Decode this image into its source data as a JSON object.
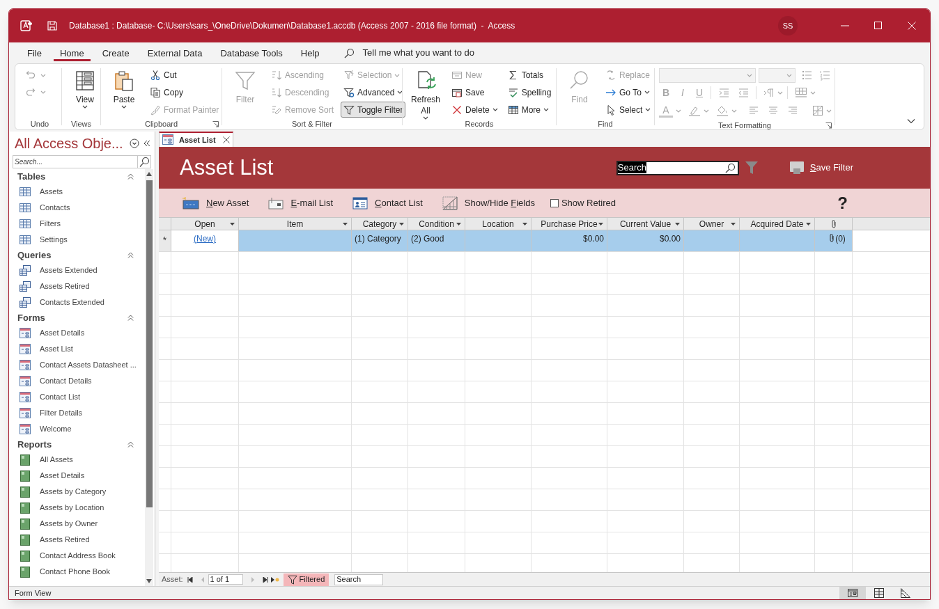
{
  "window": {
    "title": "Database1 : Database- C:\\Users\\sars_\\OneDrive\\Dokumen\\Database1.accdb (Access 2007 - 2016 file format)  -  Access",
    "user_initials": "SS"
  },
  "menu_tabs": [
    {
      "label": "File",
      "selected": false
    },
    {
      "label": "Home",
      "selected": true
    },
    {
      "label": "Create",
      "selected": false
    },
    {
      "label": "External Data",
      "selected": false
    },
    {
      "label": "Database Tools",
      "selected": false
    },
    {
      "label": "Help",
      "selected": false
    }
  ],
  "tell_me": {
    "placeholder": "Tell me what you want to do"
  },
  "ribbon": {
    "groups": [
      {
        "kind": "commands",
        "label": "Undo",
        "launcher": false,
        "items": [
          {
            "kind": "icon",
            "disabled": true,
            "dropdown": true,
            "pressed": false
          },
          {
            "kind": "icon",
            "disabled": true,
            "dropdown": true,
            "pressed": false
          }
        ]
      },
      {
        "kind": "commands",
        "label": "Views",
        "launcher": false,
        "items": [
          {
            "kind": "large",
            "label": "View",
            "disabled": false,
            "dropdown": true,
            "pressed": false
          }
        ]
      },
      {
        "kind": "commands",
        "label": "Clipboard",
        "launcher": true,
        "items": [
          {
            "kind": "large",
            "label": "Paste",
            "disabled": false,
            "dropdown": true,
            "pressed": false
          },
          {
            "kind": "small",
            "label": "Cut",
            "disabled": false,
            "dropdown": false,
            "pressed": false
          },
          {
            "kind": "small",
            "label": "Copy",
            "disabled": false,
            "dropdown": false,
            "pressed": false
          },
          {
            "kind": "small",
            "label": "Format Painter",
            "disabled": true,
            "dropdown": false,
            "pressed": false
          }
        ]
      },
      {
        "kind": "commands",
        "label": "Sort & Filter",
        "launcher": false,
        "items": [
          {
            "kind": "large",
            "label": "Filter",
            "disabled": true,
            "dropdown": false,
            "pressed": false
          },
          {
            "kind": "small",
            "label": "Ascending",
            "disabled": true,
            "dropdown": false,
            "pressed": false
          },
          {
            "kind": "small",
            "label": "Descending",
            "disabled": true,
            "dropdown": false,
            "pressed": false
          },
          {
            "kind": "small",
            "label": "Remove Sort",
            "disabled": true,
            "dropdown": false,
            "pressed": false
          },
          {
            "kind": "small",
            "label": "Selection",
            "disabled": true,
            "dropdown": true,
            "pressed": false
          },
          {
            "kind": "small",
            "label": "Advanced",
            "disabled": false,
            "dropdown": true,
            "pressed": false
          },
          {
            "kind": "small",
            "label": "Toggle Filter",
            "disabled": false,
            "dropdown": false,
            "pressed": true
          }
        ]
      },
      {
        "kind": "commands",
        "label": "Records",
        "launcher": false,
        "items": [
          {
            "kind": "large",
            "label": "Refresh All",
            "disabled": false,
            "dropdown": true,
            "pressed": false
          },
          {
            "kind": "small",
            "label": "New",
            "disabled": true,
            "dropdown": false,
            "pressed": false
          },
          {
            "kind": "small",
            "label": "Save",
            "disabled": false,
            "dropdown": false,
            "pressed": false
          },
          {
            "kind": "small",
            "label": "Delete",
            "disabled": false,
            "dropdown": true,
            "pressed": false
          },
          {
            "kind": "small",
            "label": "Totals",
            "disabled": false,
            "dropdown": false,
            "pressed": false
          },
          {
            "kind": "small",
            "label": "Spelling",
            "disabled": false,
            "dropdown": false,
            "pressed": false
          },
          {
            "kind": "small",
            "label": "More",
            "disabled": false,
            "dropdown": true,
            "pressed": false
          }
        ]
      },
      {
        "kind": "commands",
        "label": "Find",
        "launcher": false,
        "items": [
          {
            "kind": "large",
            "label": "Find",
            "disabled": true,
            "dropdown": false,
            "pressed": false
          },
          {
            "kind": "small",
            "label": "Replace",
            "disabled": true,
            "dropdown": false,
            "pressed": false
          },
          {
            "kind": "small",
            "label": "Go To",
            "disabled": false,
            "dropdown": true,
            "pressed": false
          },
          {
            "kind": "small",
            "label": "Select",
            "disabled": false,
            "dropdown": true,
            "pressed": false
          }
        ]
      },
      {
        "kind": "text_formatting",
        "label": "Text Formatting",
        "launcher": true,
        "disabled": true,
        "format_buttons": [
          {
            "label": "B",
            "kind": "bold"
          },
          {
            "label": "I",
            "kind": "italic"
          },
          {
            "label": "U",
            "kind": "underline"
          },
          {
            "label": "A",
            "kind": "font_color"
          }
        ]
      }
    ]
  },
  "navigation_pane": {
    "title": "All Access Obje...",
    "search": {
      "placeholder": "Search..."
    },
    "groups": [
      {
        "label": "Tables",
        "expanded": true,
        "items": [
          {
            "label": "Assets",
            "kind": "table"
          },
          {
            "label": "Contacts",
            "kind": "table"
          },
          {
            "label": "Filters",
            "kind": "table"
          },
          {
            "label": "Settings",
            "kind": "table"
          }
        ]
      },
      {
        "label": "Queries",
        "expanded": true,
        "items": [
          {
            "label": "Assets Extended",
            "kind": "query"
          },
          {
            "label": "Assets Retired",
            "kind": "query"
          },
          {
            "label": "Contacts Extended",
            "kind": "query"
          }
        ]
      },
      {
        "label": "Forms",
        "expanded": true,
        "items": [
          {
            "label": "Asset Details",
            "kind": "form"
          },
          {
            "label": "Asset List",
            "kind": "form"
          },
          {
            "label": "Contact Assets Datasheet ...",
            "kind": "form"
          },
          {
            "label": "Contact Details",
            "kind": "form"
          },
          {
            "label": "Contact List",
            "kind": "form"
          },
          {
            "label": "Filter Details",
            "kind": "form"
          },
          {
            "label": "Welcome",
            "kind": "form"
          }
        ]
      },
      {
        "label": "Reports",
        "expanded": true,
        "items": [
          {
            "label": "All Assets",
            "kind": "report"
          },
          {
            "label": "Asset Details",
            "kind": "report"
          },
          {
            "label": "Assets by Category",
            "kind": "report"
          },
          {
            "label": "Assets by Location",
            "kind": "report"
          },
          {
            "label": "Assets by Owner",
            "kind": "report"
          },
          {
            "label": "Assets Retired",
            "kind": "report"
          },
          {
            "label": "Contact Address Book",
            "kind": "report"
          },
          {
            "label": "Contact Phone Book",
            "kind": "report"
          }
        ]
      }
    ]
  },
  "document_tabs": [
    {
      "label": "Asset List",
      "selected": true
    }
  ],
  "form": {
    "title": "Asset List",
    "search": {
      "value": "Search",
      "text_selected": true
    },
    "save_filter": {
      "parts": [
        {
          "text": "S",
          "underline": true
        },
        {
          "text": "ave Filter",
          "underline": false
        }
      ]
    },
    "toolbar": [
      {
        "kind": "new",
        "parts": [
          {
            "text": "N",
            "underline": true
          },
          {
            "text": "ew Asset",
            "underline": false
          }
        ]
      },
      {
        "kind": "email",
        "parts": [
          {
            "text": "E",
            "underline": true
          },
          {
            "text": "-mail List",
            "underline": false
          }
        ]
      },
      {
        "kind": "contacts",
        "parts": [
          {
            "text": "C",
            "underline": true
          },
          {
            "text": "ontact List",
            "underline": false
          }
        ]
      },
      {
        "kind": "fields",
        "parts": [
          {
            "text": "Show/Hide ",
            "underline": false
          },
          {
            "text": "F",
            "underline": true
          },
          {
            "text": "ields",
            "underline": false
          }
        ]
      }
    ],
    "show_retired": {
      "label": "Show Retired",
      "checked": false
    },
    "help": "?"
  },
  "datasheet": {
    "columns": [
      {
        "label": "Open",
        "kind": "link"
      },
      {
        "label": "Item",
        "kind": "text"
      },
      {
        "label": "Category",
        "kind": "text"
      },
      {
        "label": "Condition",
        "kind": "text"
      },
      {
        "label": "Location",
        "kind": "text"
      },
      {
        "label": "Purchase Price",
        "kind": "currency"
      },
      {
        "label": "Current Value",
        "kind": "currency"
      },
      {
        "label": "Owner",
        "kind": "text"
      },
      {
        "label": "Acquired Date",
        "kind": "text"
      },
      {
        "kind": "attachment"
      }
    ],
    "rows": [
      {
        "selector": "*",
        "selected": true,
        "cells": [
          "(New)",
          null,
          "(1) Category",
          "(2) Good",
          null,
          "$0.00",
          "$0.00",
          null,
          null,
          "(0)"
        ]
      }
    ]
  },
  "record_navigator": {
    "label": "Asset:",
    "position": "1 of 1",
    "filter": {
      "label": "Filtered",
      "on": true
    },
    "search": {
      "placeholder": "Search"
    }
  },
  "status_bar": {
    "text": "Form View",
    "views": [
      {
        "selected": true
      },
      {
        "selected": false
      },
      {
        "selected": false
      }
    ]
  }
}
